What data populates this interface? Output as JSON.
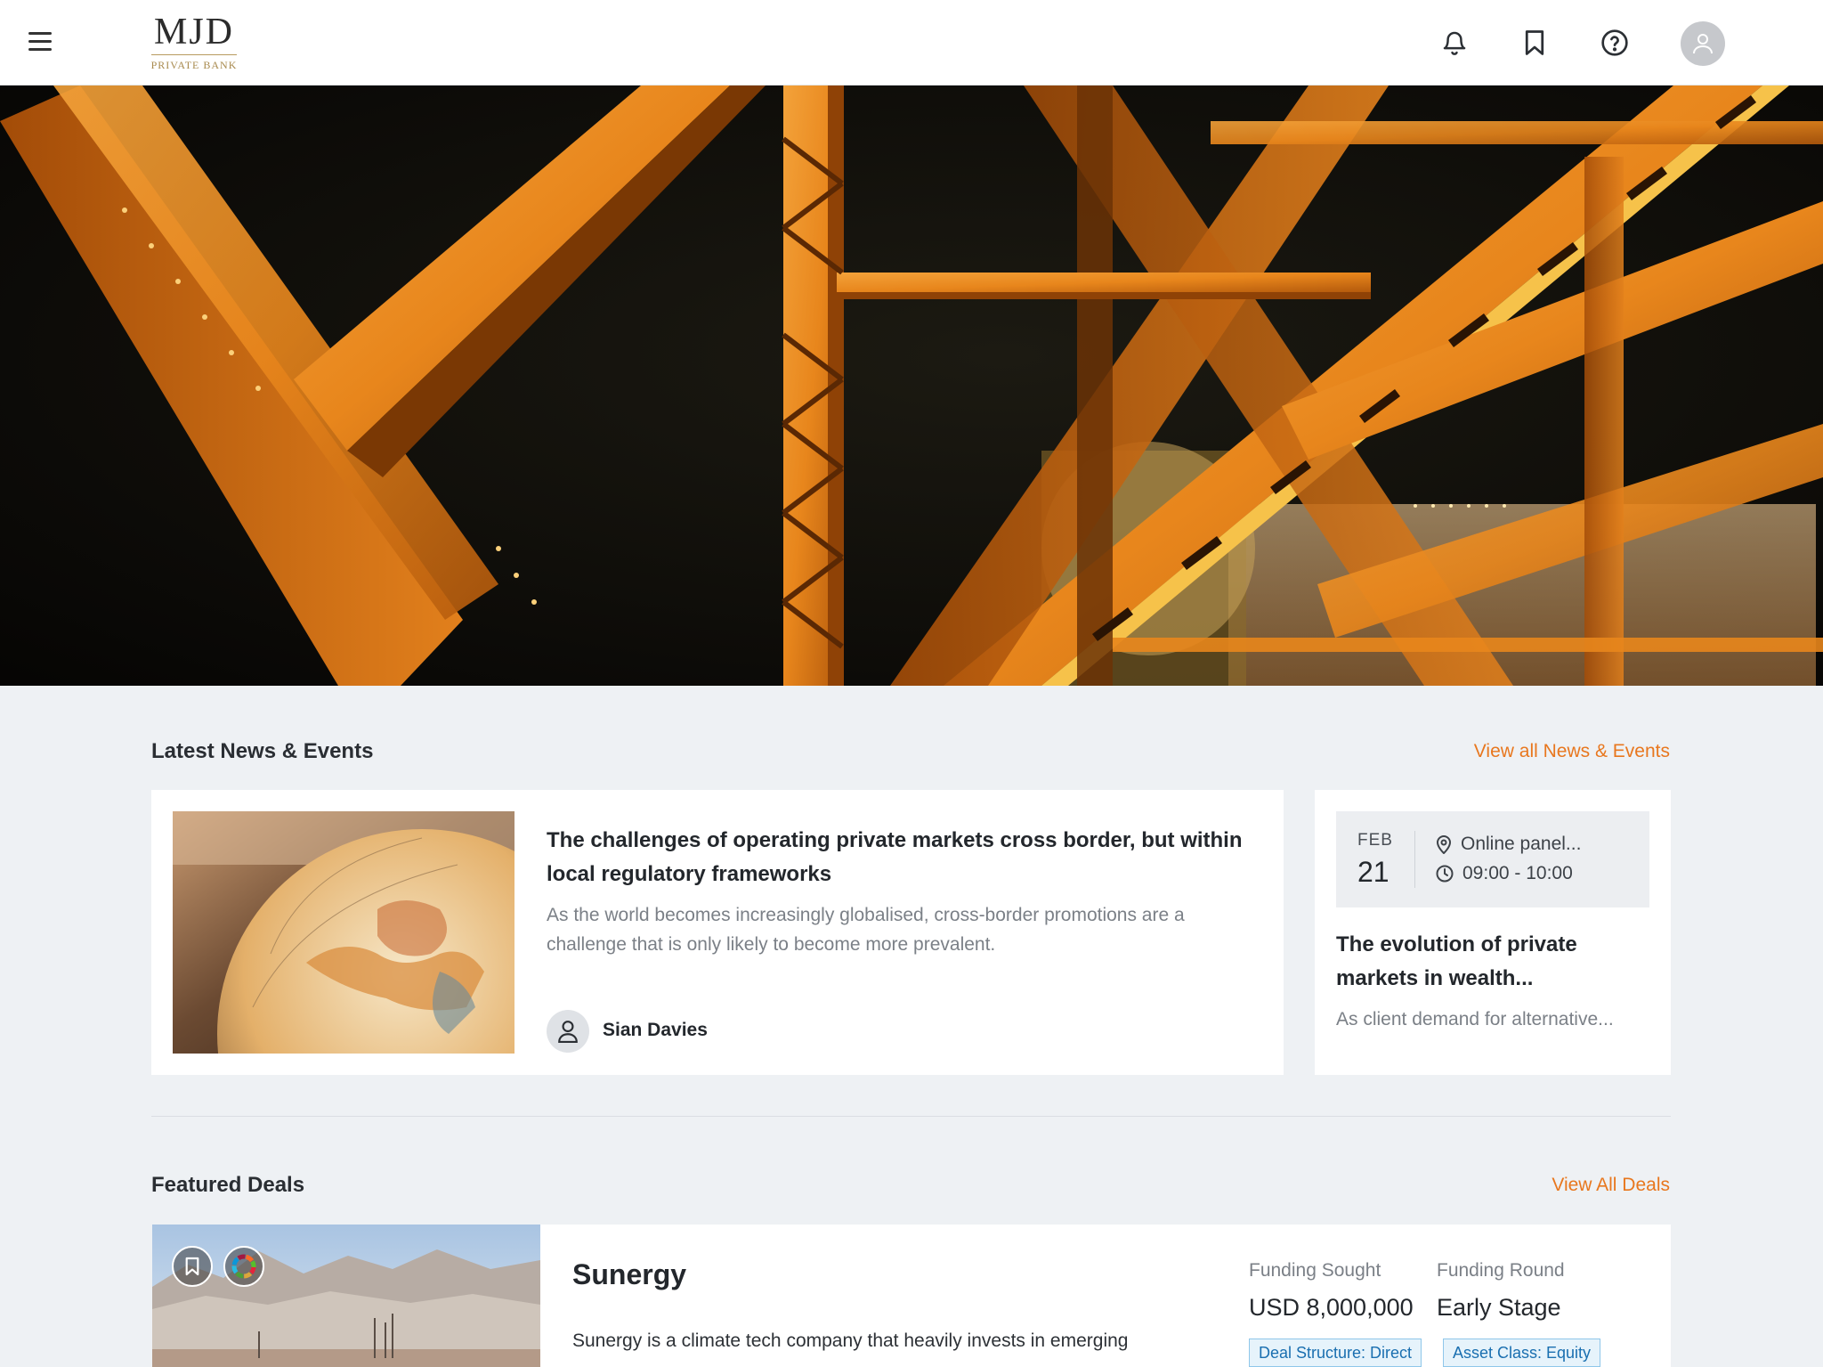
{
  "header": {
    "logo_main": "MJD",
    "logo_sub": "PRIVATE BANK",
    "icons": [
      "menu-icon",
      "bell-icon",
      "bookmark-icon",
      "help-icon",
      "user-icon"
    ]
  },
  "hero": {
    "image": "orange-steel-bridge-girders-at-night"
  },
  "news_section": {
    "title": "Latest News & Events",
    "link": "View all News & Events"
  },
  "news_article": {
    "image": "globe-closeup",
    "title": "The challenges of operating private markets cross border, but within local regulatory frameworks",
    "excerpt": "As the world becomes increasingly globalised, cross-border promotions are a challenge that is only likely to become more prevalent.",
    "author": "Sian Davies"
  },
  "event": {
    "month": "FEB",
    "day": "21",
    "location": "Online panel...",
    "time": "09:00 - 10:00",
    "title": "The evolution of private markets in wealth...",
    "excerpt": "As client demand for alternative..."
  },
  "deals_section": {
    "title": "Featured Deals",
    "link": "View All Deals"
  },
  "deal": {
    "image": "desert-landscape",
    "name": "Sunergy",
    "description": "Sunergy is a climate tech company that heavily invests in emerging",
    "funding_sought_label": "Funding Sought",
    "funding_sought_value": "USD 8,000,000",
    "funding_round_label": "Funding Round",
    "funding_round_value": "Early Stage",
    "tags": [
      "Deal Structure: Direct",
      "Asset Class: Equity"
    ]
  },
  "colors": {
    "accent": "#e8771e",
    "tag_blue": "#1a6fb0",
    "background": "#eef1f4"
  }
}
